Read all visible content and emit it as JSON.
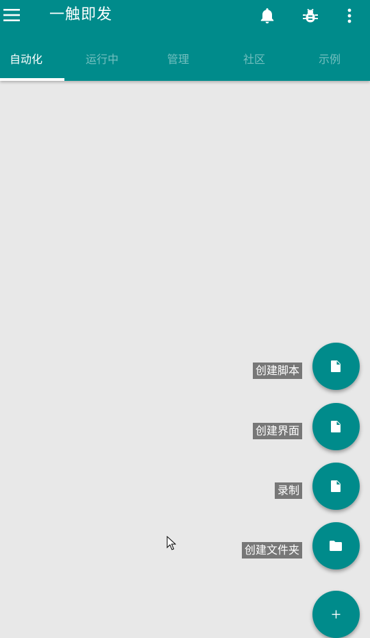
{
  "app": {
    "title": "一触即发"
  },
  "toolbar": {
    "menu_icon": "menu-icon",
    "actions": [
      "bell-icon",
      "bug-icon",
      "more-vert-icon"
    ]
  },
  "tabs": [
    {
      "label": "自动化",
      "active": true
    },
    {
      "label": "运行中",
      "active": false
    },
    {
      "label": "管理",
      "active": false
    },
    {
      "label": "社区",
      "active": false
    },
    {
      "label": "示例",
      "active": false
    }
  ],
  "fab_menu": {
    "items": [
      {
        "label": "创建脚本",
        "icon": "file-icon"
      },
      {
        "label": "创建界面",
        "icon": "file-icon"
      },
      {
        "label": "录制",
        "icon": "file-icon"
      },
      {
        "label": "创建文件夹",
        "icon": "folder-icon"
      }
    ],
    "main_icon": "plus-icon"
  },
  "colors": {
    "primary": "#008b8b",
    "background": "#e8e8e8",
    "label_bg": "#777777"
  }
}
